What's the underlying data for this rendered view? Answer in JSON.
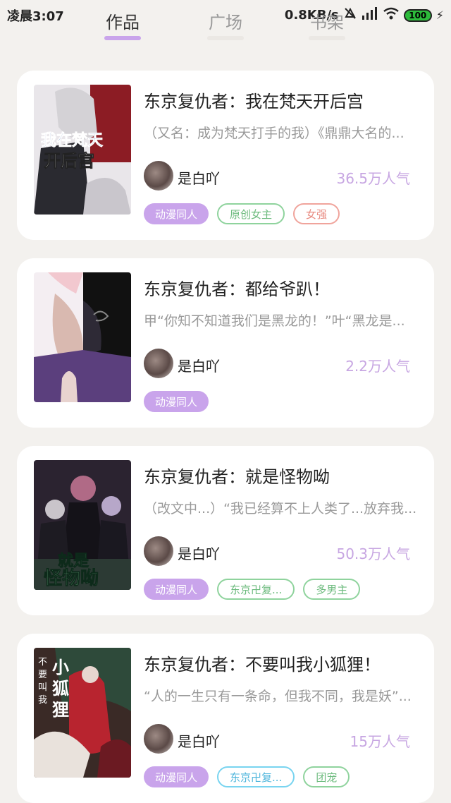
{
  "status": {
    "time": "凌晨3:07",
    "speed": "0.8KB/s",
    "battery": "100"
  },
  "tabs": [
    {
      "label": "作品"
    },
    {
      "label": "广场"
    },
    {
      "label": "书架"
    }
  ],
  "colors": {
    "accent": "#c9a4eb",
    "popularity": "#c7a6e2"
  },
  "works": [
    {
      "title": "东京复仇者：我在梵天开后宫",
      "desc": "（又名：成为梵天打手的我）《鼎鼎大名的...",
      "author": "是白吖",
      "popularity": "36.5万人气",
      "cover_text": "我在梵天开后宫",
      "tags": [
        {
          "label": "动漫同人",
          "style": "fill"
        },
        {
          "label": "原创女主",
          "style": "green"
        },
        {
          "label": "女强",
          "style": "red"
        }
      ]
    },
    {
      "title": "东京复仇者：都给爷趴！",
      "desc": "甲“你知不知道我们是黑龙的！”叶“黑龙是...",
      "author": "是白吖",
      "popularity": "2.2万人气",
      "cover_text": "",
      "tags": [
        {
          "label": "动漫同人",
          "style": "fill"
        }
      ]
    },
    {
      "title": "东京复仇者：就是怪物呦",
      "desc": "（改文中...）“我已经算不上人类了...放弃我...",
      "author": "是白吖",
      "popularity": "50.3万人气",
      "cover_text": "就是怪物呦",
      "tags": [
        {
          "label": "动漫同人",
          "style": "fill"
        },
        {
          "label": "东京卍复...",
          "style": "green"
        },
        {
          "label": "多男主",
          "style": "green"
        }
      ]
    },
    {
      "title": "东京复仇者：不要叫我小狐狸！",
      "desc": "“人的一生只有一条命，但我不同，我是妖”...",
      "author": "是白吖",
      "popularity": "15万人气",
      "cover_text": "不要叫我小狐狸",
      "tags": [
        {
          "label": "动漫同人",
          "style": "fill"
        },
        {
          "label": "东京卍复...",
          "style": "cyan"
        },
        {
          "label": "团宠",
          "style": "green"
        }
      ]
    }
  ]
}
